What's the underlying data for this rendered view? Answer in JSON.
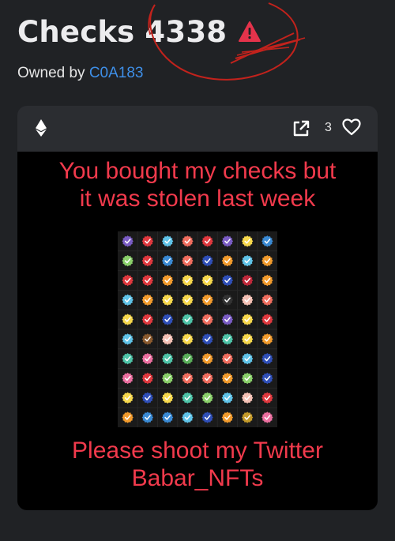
{
  "header": {
    "title": "Checks 4338",
    "owned_by_label": "Owned by",
    "owner": "C0A183"
  },
  "card": {
    "like_count": "3",
    "message_line1": "You bought my checks but",
    "message_line2": "it was stolen last week",
    "message_line3": "Please shoot my Twitter",
    "message_line4": "Babar_NFTs"
  },
  "icons": [
    "warning-icon",
    "ethereum-icon",
    "external-link-icon",
    "heart-icon",
    "check-icon"
  ],
  "colors": {
    "accent_link": "#3e8fe8",
    "warning_red": "#e5334b",
    "message_red": "#f13a4c",
    "check_palette": [
      "#e0383e",
      "#f06d5e",
      "#f7d84c",
      "#5fc3e8",
      "#2f4fb8",
      "#5aaf5a",
      "#f29b2c",
      "#ec6fa0",
      "#7a5cc4",
      "#3a8ad4",
      "#8ad06a",
      "#c49a2a",
      "#4ec4a8",
      "#f4c0b4",
      "#8a5a2e"
    ]
  },
  "check_grid": {
    "columns": 8,
    "rows": 10,
    "cells": [
      [
        "#7a5cc4",
        "#e0383e",
        "#5fc3e8",
        "#f06d5e",
        "#e0383e",
        "#7a5cc4",
        "#f7d84c",
        "#3a8ad4"
      ],
      [
        "#8ad06a",
        "#e0383e",
        "#3a8ad4",
        "#f06d5e",
        "#2f4fb8",
        "#f29b2c",
        "#5fc3e8",
        "#f29b2c"
      ],
      [
        "#e0383e",
        "#e0383e",
        "#f29b2c",
        "#f7d84c",
        "#f7d84c",
        "#2f4fb8",
        "#c0283a",
        "#f29b2c"
      ],
      [
        "#5fc3e8",
        "#f29b2c",
        "#f7d84c",
        "#f7d84c",
        "#f29b2c",
        "#333333",
        "#f4c0b4",
        "#f06d5e"
      ],
      [
        "#f7d84c",
        "#e0383e",
        "#2f4fb8",
        "#4ec4a8",
        "#f06d5e",
        "#7a5cc4",
        "#f7d84c",
        "#e0383e"
      ],
      [
        "#5fc3e8",
        "#8a5a2e",
        "#f4c0b4",
        "#f7d84c",
        "#2f4fb8",
        "#4ec4a8",
        "#f7d84c",
        "#f29b2c"
      ],
      [
        "#4ec4a8",
        "#ec6fa0",
        "#4ec4a8",
        "#5aaf5a",
        "#f29b2c",
        "#f06d5e",
        "#5fc3e8",
        "#2f4fb8"
      ],
      [
        "#ec6fa0",
        "#e0383e",
        "#8ad06a",
        "#f06d5e",
        "#f06d5e",
        "#f29b2c",
        "#8ad06a",
        "#2f4fb8"
      ],
      [
        "#f7d84c",
        "#2f4fb8",
        "#f7d84c",
        "#4ec4a8",
        "#8ad06a",
        "#5fc3e8",
        "#f4c0b4",
        "#e0383e"
      ],
      [
        "#f29b2c",
        "#3a8ad4",
        "#3a8ad4",
        "#5fc3e8",
        "#2f4fb8",
        "#f29b2c",
        "#c49a2a",
        "#ec6fa0"
      ]
    ]
  }
}
